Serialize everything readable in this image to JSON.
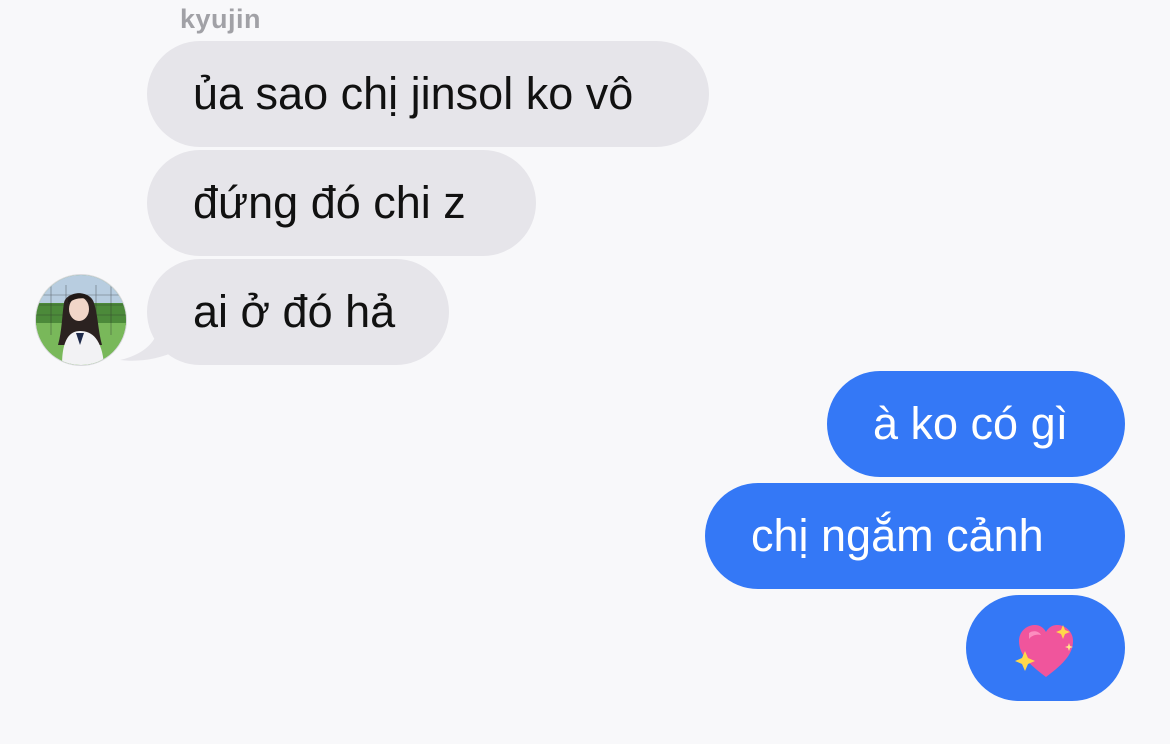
{
  "thread": {
    "sender_name": "kyujin",
    "incoming": [
      "ủa sao chị jinsol ko vô",
      "đứng đó chi z",
      "ai ở đó hả"
    ],
    "outgoing": [
      "à ko có gì",
      "chị ngắm cảnh"
    ],
    "outgoing_emoji": "sparkling-heart-icon"
  },
  "colors": {
    "incoming_bubble": "#e6e5ea",
    "outgoing_bubble": "#3478f6",
    "background": "#f8f8fa",
    "sender_name": "#a1a1a6"
  }
}
